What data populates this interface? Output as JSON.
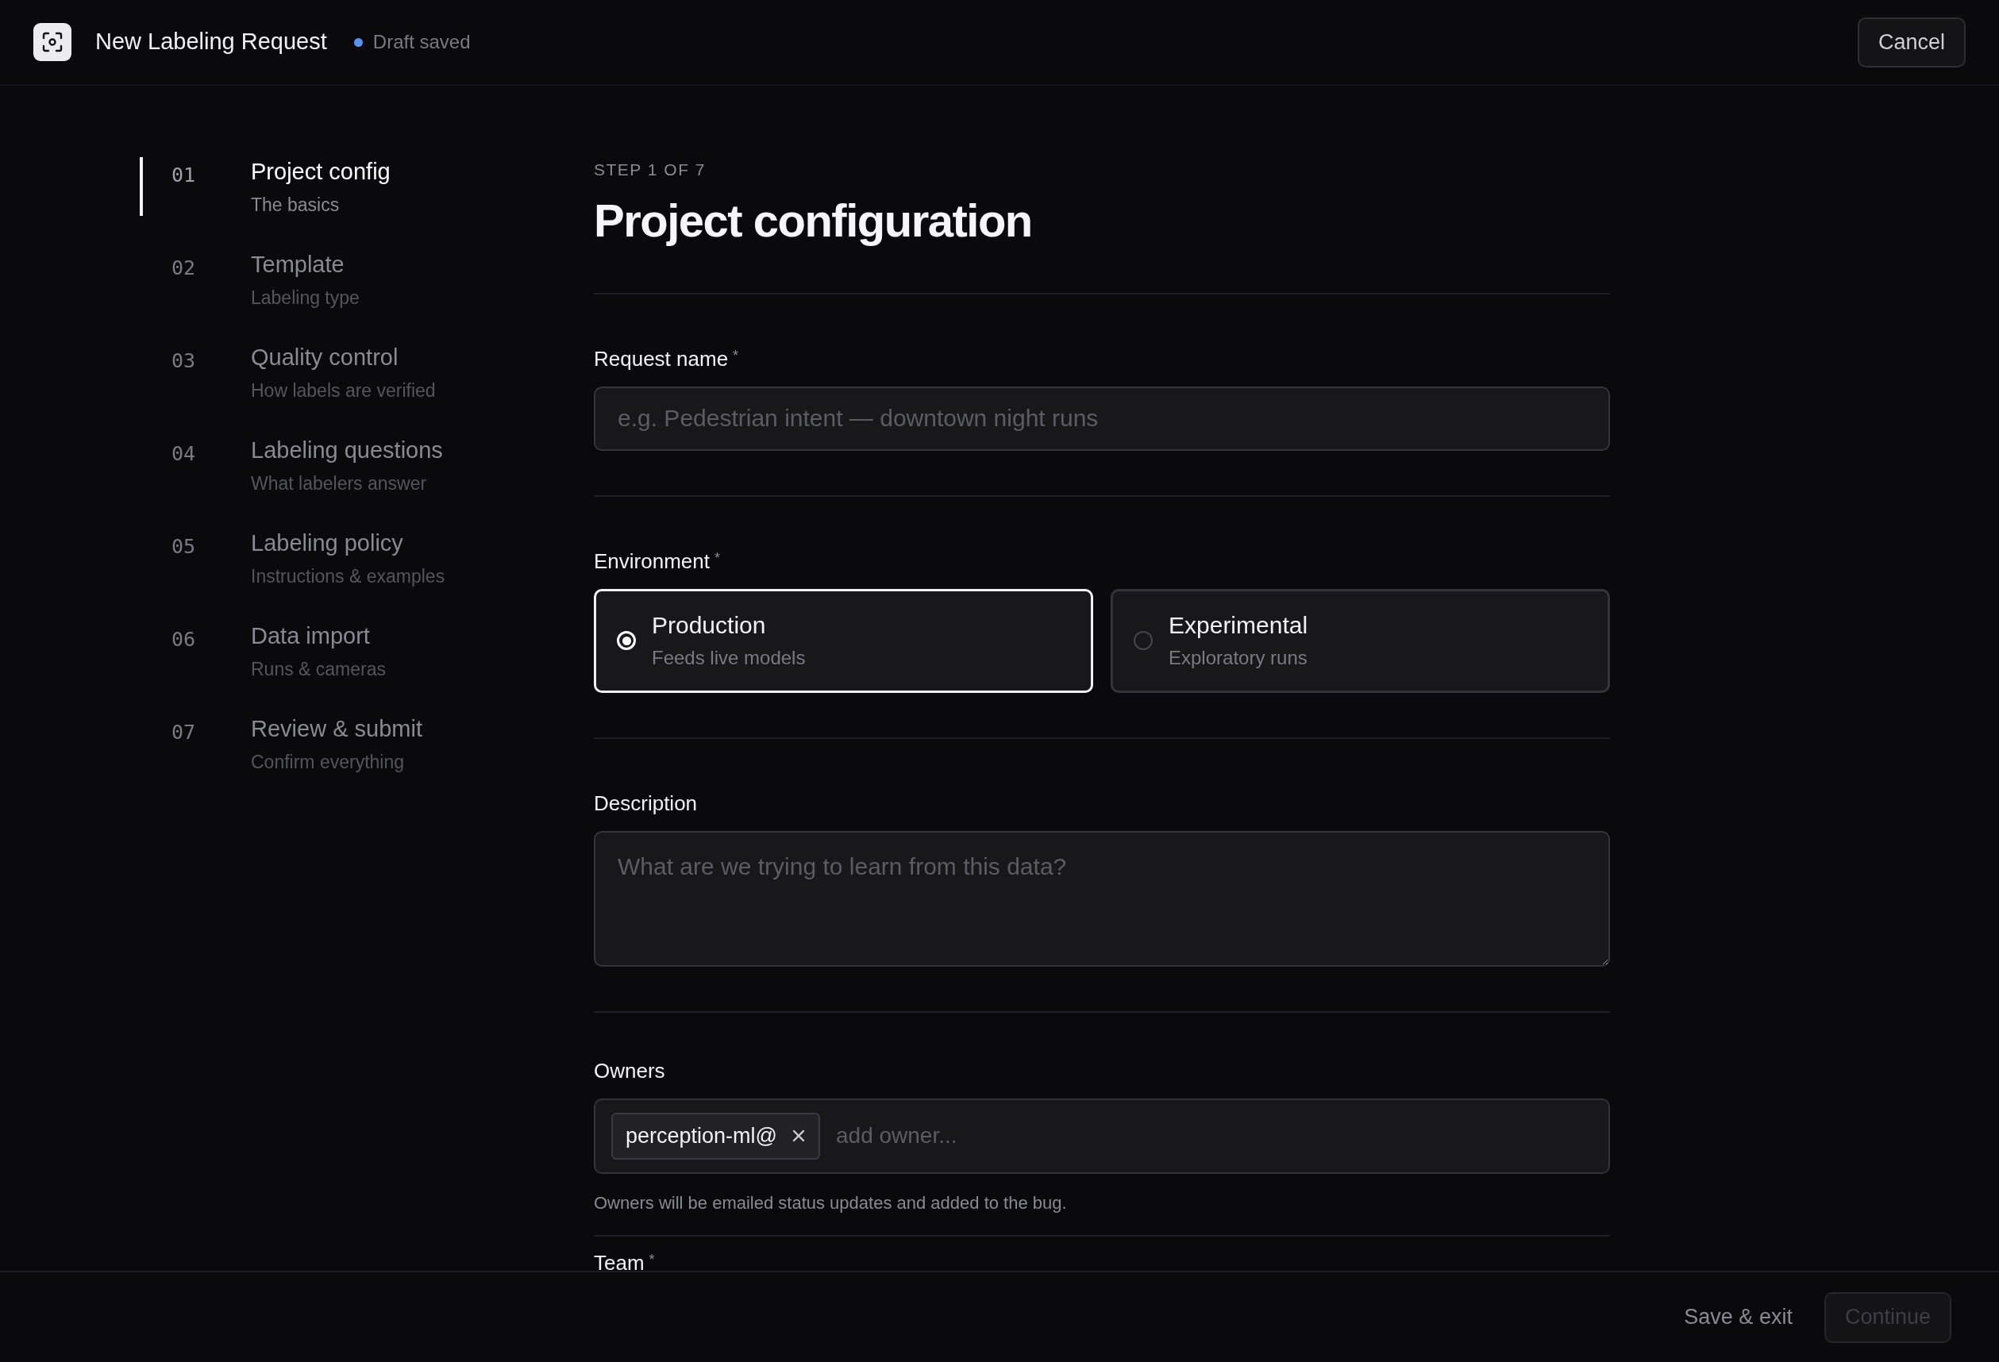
{
  "header": {
    "title": "New Labeling Request",
    "status": "Draft saved",
    "cancel": "Cancel"
  },
  "steps": [
    {
      "number": "01",
      "title": "Project config",
      "subtitle": "The basics",
      "selected": true
    },
    {
      "number": "02",
      "title": "Template",
      "subtitle": "Labeling type",
      "selected": false
    },
    {
      "number": "03",
      "title": "Quality control",
      "subtitle": "How labels are verified",
      "selected": false
    },
    {
      "number": "04",
      "title": "Labeling questions",
      "subtitle": "What labelers answer",
      "selected": false
    },
    {
      "number": "05",
      "title": "Labeling policy",
      "subtitle": "Instructions & examples",
      "selected": false
    },
    {
      "number": "06",
      "title": "Data import",
      "subtitle": "Runs & cameras",
      "selected": false
    },
    {
      "number": "07",
      "title": "Review & submit",
      "subtitle": "Confirm everything",
      "selected": false
    }
  ],
  "form": {
    "eyebrow": "STEP 1 OF 7",
    "title": "Project configuration",
    "fields": [
      {
        "kind": "text",
        "label": "Request name",
        "required_mark": "*",
        "placeholder": "e.g. Pedestrian intent — downtown night runs"
      },
      {
        "kind": "radio",
        "label": "Environment",
        "required_mark": "*",
        "options": [
          {
            "title": "Production",
            "subtitle": "Feeds live models",
            "selected": true
          },
          {
            "title": "Experimental",
            "subtitle": "Exploratory runs",
            "selected": false
          }
        ]
      },
      {
        "kind": "textarea",
        "label": "Description",
        "placeholder": "What are we trying to learn from this data?"
      },
      {
        "kind": "tags",
        "label": "Owners",
        "tags": [
          "perception-ml@"
        ],
        "placeholder": "add owner...",
        "hint": "Owners will be emailed status updates and added to the bug."
      },
      {
        "kind": "cut",
        "label": "Team",
        "required_mark": "*"
      }
    ]
  },
  "footer": {
    "secondary": "Save & exit",
    "primary": "Continue",
    "primary_disabled": true
  }
}
